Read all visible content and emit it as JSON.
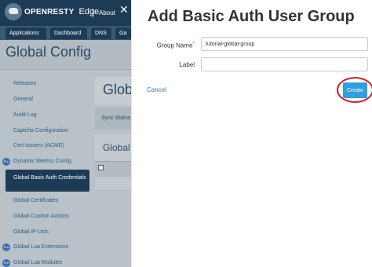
{
  "brand": {
    "logo_text": "OPENRESTY",
    "logo_suffix": "Edge",
    "about_label": "About"
  },
  "nav": {
    "tabs": [
      "Applications",
      "Dashboard",
      "DNS",
      "Ga"
    ]
  },
  "page": {
    "title": "Global Config"
  },
  "sidebar": {
    "items": [
      {
        "label": "Releases",
        "pro": false
      },
      {
        "label": "General",
        "pro": false
      },
      {
        "label": "Audit Log",
        "pro": false
      },
      {
        "label": "Captcha Configuration",
        "pro": false
      },
      {
        "label": "Cert Issuers (ACME)",
        "pro": false
      },
      {
        "label": "Dynamic Metrics Config",
        "pro": true
      },
      {
        "label": "Global Basic Auth Credentials",
        "pro": false,
        "active": true
      },
      {
        "label": "Global Certificates",
        "pro": false
      },
      {
        "label": "Global Custom Actions",
        "pro": false
      },
      {
        "label": "Global IP Lists",
        "pro": false
      },
      {
        "label": "Global Lua Extensions",
        "pro": true
      },
      {
        "label": "Global Lua Modules",
        "pro": true
      }
    ],
    "pro_badge": "Pro"
  },
  "content": {
    "title": "Glob",
    "sync_status_label": "Sync Status",
    "table_title": "Global"
  },
  "dialog": {
    "close_glyph": "✕",
    "title": "Add Basic Auth User Group",
    "fields": {
      "group_name": {
        "label": "Group Name",
        "required_mark": "*",
        "value": "tutorial-global-group"
      },
      "label": {
        "label": "Label",
        "value": ""
      }
    },
    "cancel_label": "Cancel",
    "create_label": "Create"
  },
  "colors": {
    "topbar": "#1d3b55",
    "primary_button": "#2f9fe0",
    "highlight_ring": "#d42020",
    "link": "#337ab7"
  }
}
